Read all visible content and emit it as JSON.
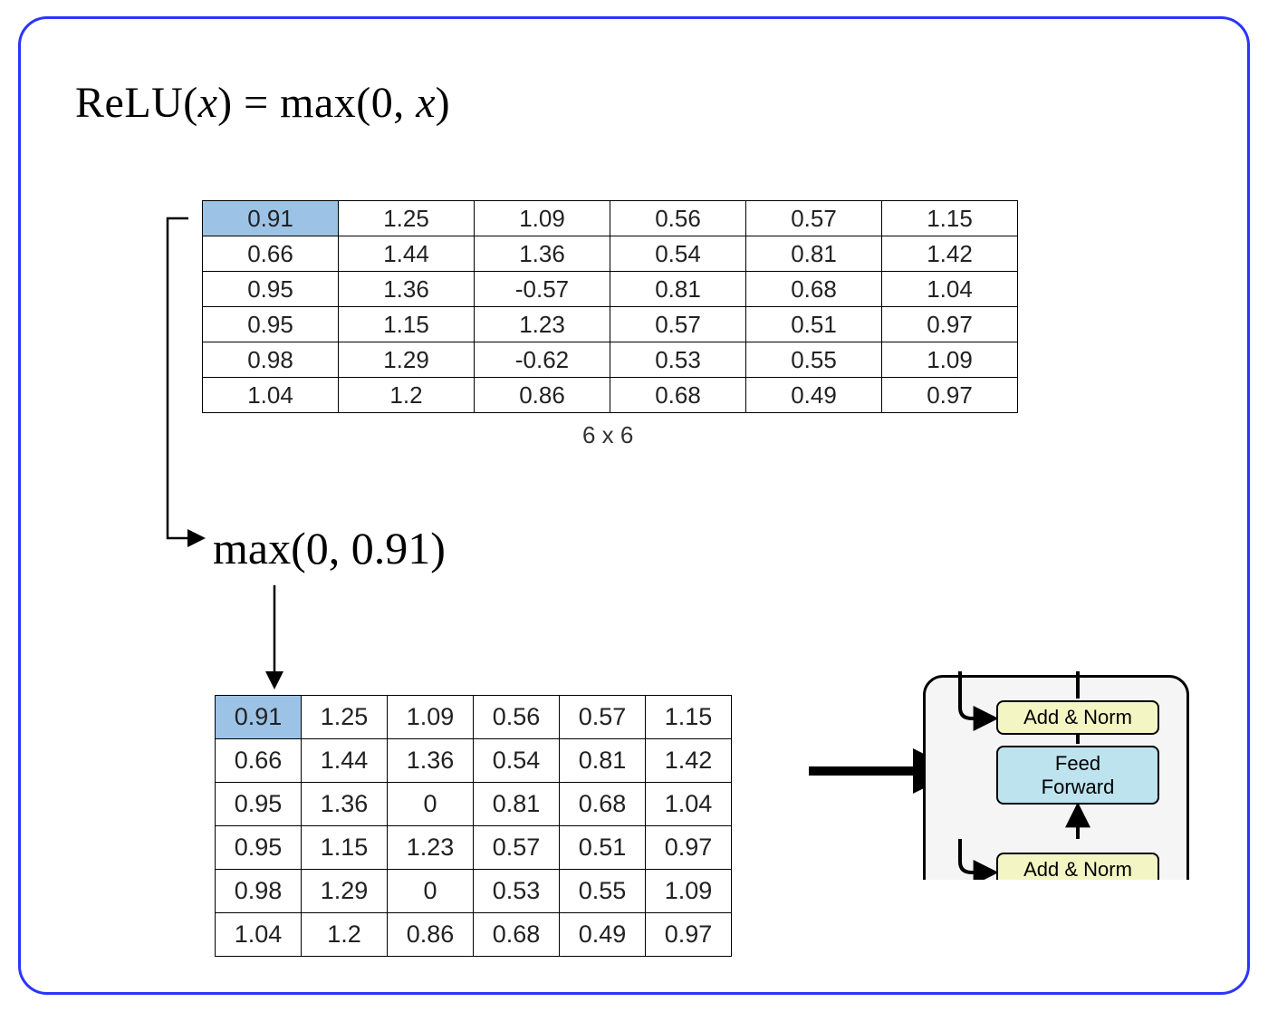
{
  "formula": {
    "text": "ReLU(x) = max(0, x)"
  },
  "dim_label": "6 x 6",
  "maxcalc": "max(0, 0.91)",
  "input_matrix": [
    [
      0.91,
      1.25,
      1.09,
      0.56,
      0.57,
      1.15
    ],
    [
      0.66,
      1.44,
      1.36,
      0.54,
      0.81,
      1.42
    ],
    [
      0.95,
      1.36,
      -0.57,
      0.81,
      0.68,
      1.04
    ],
    [
      0.95,
      1.15,
      1.23,
      0.57,
      0.51,
      0.97
    ],
    [
      0.98,
      1.29,
      -0.62,
      0.53,
      0.55,
      1.09
    ],
    [
      1.04,
      1.2,
      0.86,
      0.68,
      0.49,
      0.97
    ]
  ],
  "output_matrix": [
    [
      0.91,
      1.25,
      1.09,
      0.56,
      0.57,
      1.15
    ],
    [
      0.66,
      1.44,
      1.36,
      0.54,
      0.81,
      1.42
    ],
    [
      0.95,
      1.36,
      0,
      0.81,
      0.68,
      1.04
    ],
    [
      0.95,
      1.15,
      1.23,
      0.57,
      0.51,
      0.97
    ],
    [
      0.98,
      1.29,
      0,
      0.53,
      0.55,
      1.09
    ],
    [
      1.04,
      1.2,
      0.86,
      0.68,
      0.49,
      0.97
    ]
  ],
  "highlight_cell": {
    "row": 0,
    "col": 0
  },
  "transformer_mini": {
    "addnorm_top": "Add & Norm",
    "feedforward": "Feed\nForward",
    "addnorm_bottom": "Add & Norm"
  }
}
